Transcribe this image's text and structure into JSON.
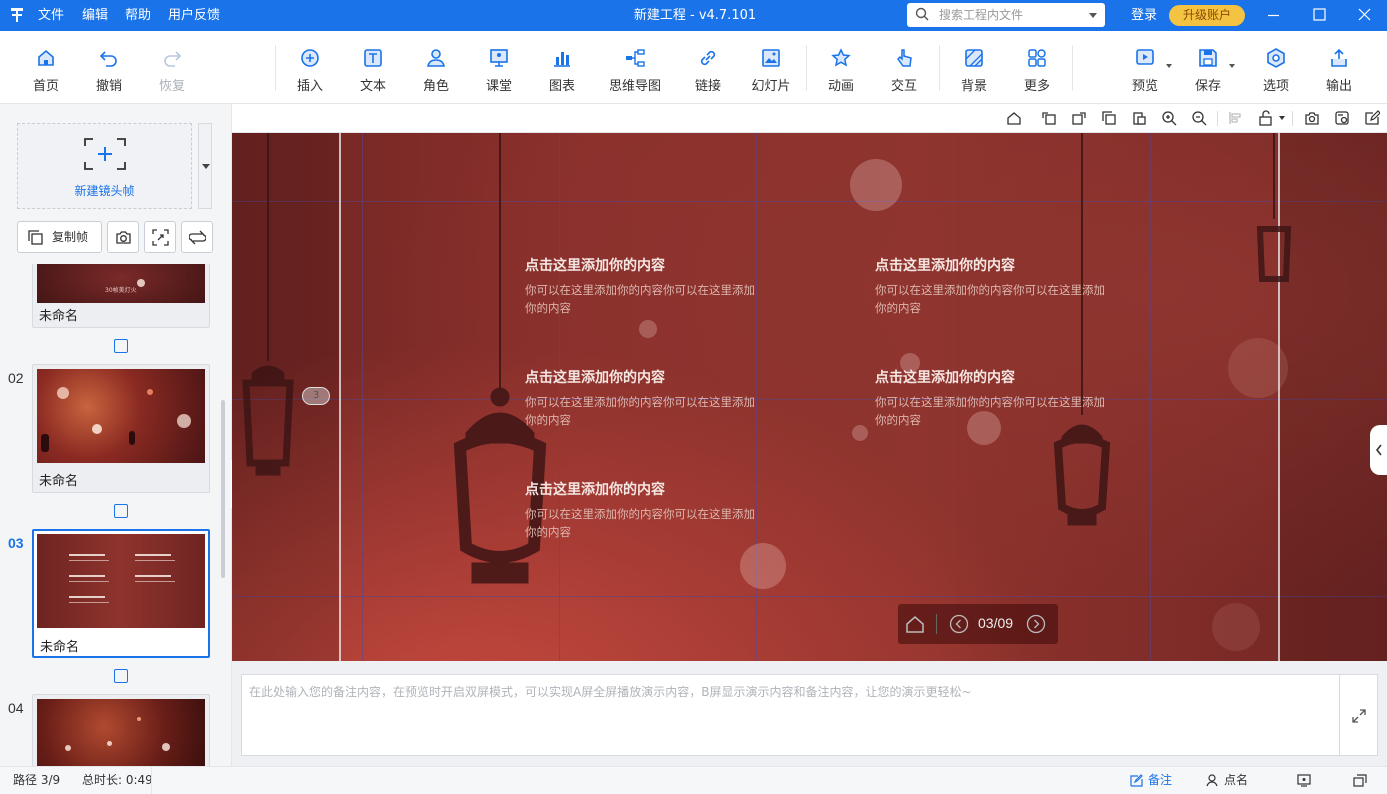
{
  "titlebar": {
    "menus": [
      "文件",
      "编辑",
      "帮助",
      "用户反馈"
    ],
    "title": "新建工程 - v4.7.101",
    "search_placeholder": "搜索工程内文件",
    "login": "登录",
    "upgrade": "升级账户",
    "accent": "#1a73e8"
  },
  "toolbar": {
    "home": "首页",
    "undo": "撤销",
    "redo": "恢复",
    "insert": "插入",
    "text": "文本",
    "role": "角色",
    "classroom": "课堂",
    "chart": "图表",
    "mindmap": "思维导图",
    "link": "链接",
    "slideshow": "幻灯片",
    "animation": "动画",
    "interact": "交互",
    "background": "背景",
    "more": "更多",
    "preview": "预览",
    "save": "保存",
    "options": "选项",
    "export": "输出"
  },
  "leftpanel": {
    "new_frame": "新建镜头帧",
    "copy_frame": "复制帧",
    "thumbs": [
      {
        "num": "",
        "name": "未命名",
        "thumb_text": "30帧美灯火"
      },
      {
        "num": "02",
        "name": "未命名"
      },
      {
        "num": "03",
        "name": "未命名"
      },
      {
        "num": "04",
        "name": ""
      }
    ]
  },
  "slide": {
    "items": [
      {
        "title": "点击这里添加你的内容",
        "body": "你可以在这里添加你的内容你可以在这里添加你的内容"
      },
      {
        "title": "点击这里添加你的内容",
        "body": "你可以在这里添加你的内容你可以在这里添加你的内容"
      },
      {
        "title": "点击这里添加你的内容",
        "body": "你可以在这里添加你的内容你可以在这里添加你的内容"
      },
      {
        "title": "点击这里添加你的内容",
        "body": "你可以在这里添加你的内容你可以在这里添加你的内容"
      },
      {
        "title": "点击这里添加你的内容",
        "body": "你可以在这里添加你的内容你可以在这里添加你的内容"
      }
    ],
    "badge": "3",
    "page_indicator": "03/09"
  },
  "notes": {
    "placeholder": "在此处输入您的备注内容，在预览时开启双屏模式，可以实现A屏全屏播放演示内容，B屏显示演示内容和备注内容，让您的演示更轻松~"
  },
  "statusbar": {
    "path": "路径 3/9",
    "duration": "总时长: 0:49",
    "notes": "备注",
    "rollcall": "点名"
  }
}
